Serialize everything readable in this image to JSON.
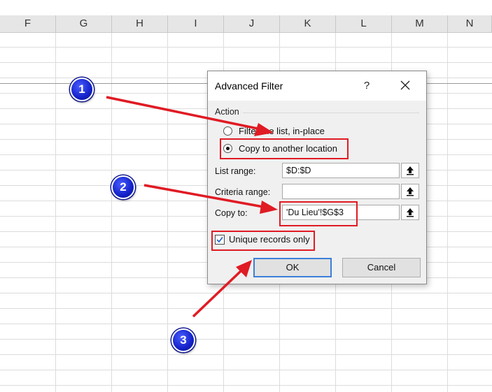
{
  "sheet": {
    "columns": [
      "F",
      "G",
      "H",
      "I",
      "J",
      "K",
      "L",
      "M",
      "N"
    ]
  },
  "dialog": {
    "title": "Advanced Filter",
    "help_label": "?",
    "action_label": "Action",
    "radio_filter_label": "Filter the list, in-place",
    "radio_filter_selected": false,
    "radio_copy_label": "Copy to another location",
    "radio_copy_selected": true,
    "list_range_label": "List range:",
    "list_range_value": "$D:$D",
    "criteria_range_label": "Criteria range:",
    "criteria_range_value": "",
    "copy_to_label": "Copy to:",
    "copy_to_value": "'Du Lieu'!$G$3",
    "unique_label": "Unique records only",
    "unique_checked": true,
    "ok_label": "OK",
    "cancel_label": "Cancel"
  },
  "annotations": {
    "steps": [
      "1",
      "2",
      "3"
    ],
    "highlight_color": "#e01b24",
    "badge_color": "#1322c9"
  }
}
